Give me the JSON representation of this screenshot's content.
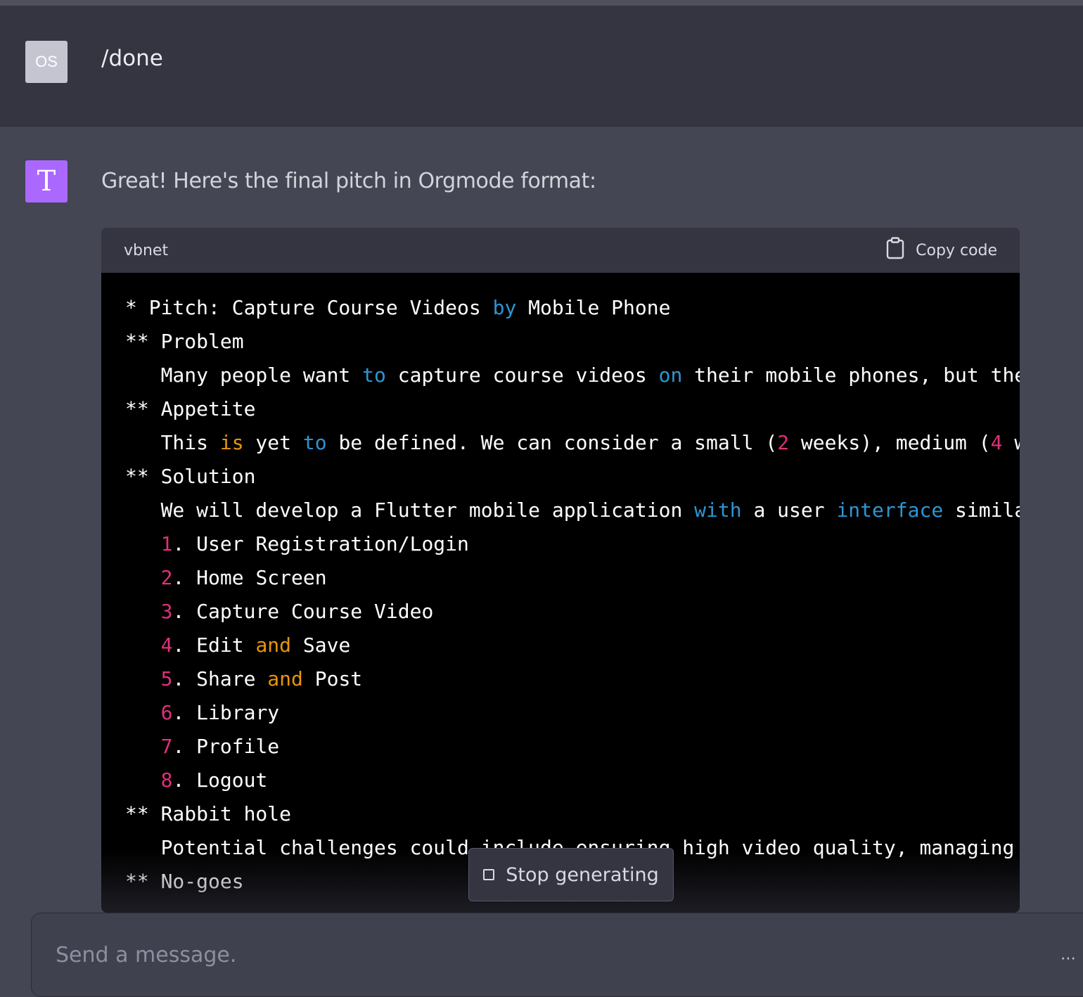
{
  "conversation": {
    "user": {
      "avatar_text": "OS",
      "message": "/done"
    },
    "assistant": {
      "avatar_text": "T",
      "intro": "Great! Here's the final pitch in Orgmode format:",
      "code_block": {
        "language": "vbnet",
        "copy_label": "Copy code",
        "lines": [
          [
            {
              "t": "* Pitch: Capture Course Videos "
            },
            {
              "t": "by",
              "c": "kw"
            },
            {
              "t": " Mobile Phone"
            }
          ],
          [
            {
              "t": "** Problem"
            }
          ],
          [
            {
              "t": "   Many people want "
            },
            {
              "t": "to",
              "c": "kw"
            },
            {
              "t": " capture course videos "
            },
            {
              "t": "on",
              "c": "kw"
            },
            {
              "t": " their mobile phones, but the"
            }
          ],
          [
            {
              "t": "** Appetite"
            }
          ],
          [
            {
              "t": "   This "
            },
            {
              "t": "is",
              "c": "kw2"
            },
            {
              "t": " yet "
            },
            {
              "t": "to",
              "c": "kw"
            },
            {
              "t": " be defined. We can consider a small ("
            },
            {
              "t": "2",
              "c": "num"
            },
            {
              "t": " weeks), medium ("
            },
            {
              "t": "4",
              "c": "num"
            },
            {
              "t": " w"
            }
          ],
          [
            {
              "t": "** Solution"
            }
          ],
          [
            {
              "t": "   We will develop a Flutter mobile application "
            },
            {
              "t": "with",
              "c": "kw"
            },
            {
              "t": " a user "
            },
            {
              "t": "interface",
              "c": "kw"
            },
            {
              "t": " simila"
            }
          ],
          [
            {
              "t": "   "
            },
            {
              "t": "1",
              "c": "num"
            },
            {
              "t": ". User Registration/Login"
            }
          ],
          [
            {
              "t": "   "
            },
            {
              "t": "2",
              "c": "num"
            },
            {
              "t": ". Home Screen"
            }
          ],
          [
            {
              "t": "   "
            },
            {
              "t": "3",
              "c": "num"
            },
            {
              "t": ". Capture Course Video"
            }
          ],
          [
            {
              "t": "   "
            },
            {
              "t": "4",
              "c": "num"
            },
            {
              "t": ". Edit "
            },
            {
              "t": "and",
              "c": "kw2"
            },
            {
              "t": " Save"
            }
          ],
          [
            {
              "t": "   "
            },
            {
              "t": "5",
              "c": "num"
            },
            {
              "t": ". Share "
            },
            {
              "t": "and",
              "c": "kw2"
            },
            {
              "t": " Post"
            }
          ],
          [
            {
              "t": "   "
            },
            {
              "t": "6",
              "c": "num"
            },
            {
              "t": ". Library"
            }
          ],
          [
            {
              "t": "   "
            },
            {
              "t": "7",
              "c": "num"
            },
            {
              "t": ". Profile"
            }
          ],
          [
            {
              "t": "   "
            },
            {
              "t": "8",
              "c": "num"
            },
            {
              "t": ". Logout"
            }
          ],
          [
            {
              "t": "** Rabbit hole"
            }
          ],
          [
            {
              "t": "   Potential challenges could include ensuring high video quality, managing"
            }
          ],
          [
            {
              "t": "** No-goes"
            }
          ]
        ]
      }
    }
  },
  "controls": {
    "stop_label": "Stop generating",
    "input_placeholder": "Send a message."
  },
  "icons": [
    "clipboard-icon",
    "stop-square-icon",
    "more-icon"
  ],
  "colors": {
    "keyword_blue": "#2e95d3",
    "keyword_orange": "#e9950c",
    "number_pink": "#df3079",
    "assistant_avatar": "#ab68ff"
  }
}
